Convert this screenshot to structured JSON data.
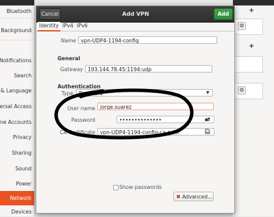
{
  "background": {
    "sidebar_items": [
      "Bluetooth",
      "Background",
      "Notifications",
      "Search",
      "Region & Language",
      "Universal Access",
      "Online Accounts",
      "Privacy",
      "Sharing",
      "Sound",
      "Power",
      "Network",
      "Devices"
    ],
    "sidebar_active_index": 11,
    "right_plus": "+",
    "right_gear": "⚙"
  },
  "dialog": {
    "cancel_label": "Cancel",
    "title": "Add VPN",
    "add_label": "Add",
    "tabs": [
      "Identity",
      "IPv4",
      "IPv6"
    ],
    "active_tab": "Identity",
    "name_label": "Name",
    "name_value": "vpn-UDP4-1194-config",
    "general": {
      "section_title": "General",
      "gateway_label": "Gateway",
      "gateway_value": "193.144.78.45:1194:udp"
    },
    "authentication": {
      "section_title": "Authentication",
      "type_label": "Type",
      "type_value": "Password",
      "username_label": "User name",
      "username_value": "jorge.suarez",
      "password_label": "Password",
      "password_value": "••••••••••••••",
      "ca_label": "CA Certificate",
      "ca_value": "vpn-UDP4-1194-config-ca.pem"
    },
    "show_passwords_label": "Show passwords",
    "show_passwords_checked": false,
    "advanced_label": "Advanced..."
  },
  "colors": {
    "accent": "#e95420",
    "add_button": "#2e8f3a",
    "titlebar": "#2f2f2d",
    "annotation_stroke": "#000000"
  },
  "icons": {
    "type_dropdown": "chevron-down-icon",
    "password_field": "password-storage-icon",
    "ca_field": "file-chooser-icon",
    "advanced_button": "tools-icon"
  }
}
